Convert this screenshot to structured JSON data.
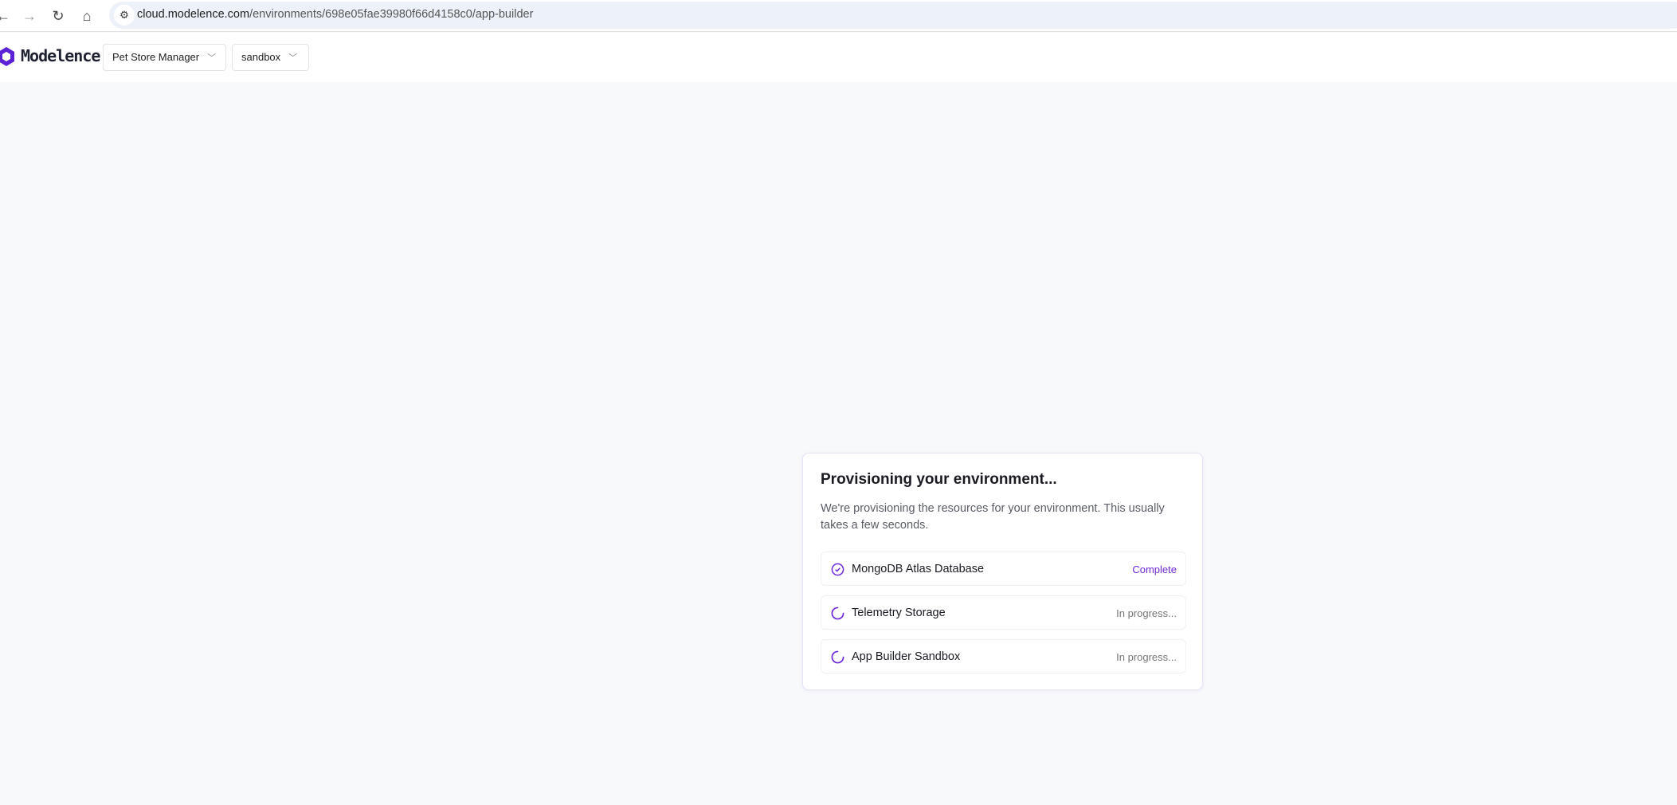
{
  "browser": {
    "url_host": "cloud.modelence.com",
    "url_path": "/environments/698e05fae39980f66d4158c0/app-builder"
  },
  "header": {
    "brand": "Modelence",
    "project": "Pet Store Manager",
    "environment": "sandbox"
  },
  "card": {
    "title": "Provisioning your environment...",
    "description": "We're provisioning the resources for your environment. This usually takes a few seconds.",
    "items": [
      {
        "name": "MongoDB Atlas Database",
        "status": "Complete"
      },
      {
        "name": "Telemetry Storage",
        "status": "In progress..."
      },
      {
        "name": "App Builder Sandbox",
        "status": "In progress..."
      }
    ]
  },
  "colors": {
    "accent": "#6d28d9",
    "muted": "#777777"
  }
}
